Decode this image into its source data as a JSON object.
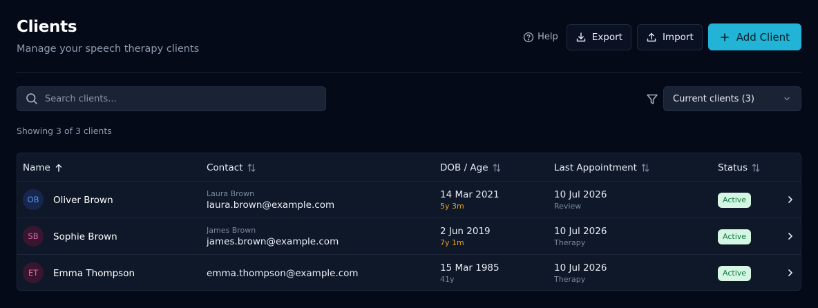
{
  "header": {
    "title": "Clients",
    "subtitle": "Manage your speech therapy clients"
  },
  "toolbar": {
    "help_label": "Help",
    "export_label": "Export",
    "import_label": "Import",
    "add_label": "Add Client"
  },
  "search": {
    "placeholder": "Search clients...",
    "value": ""
  },
  "filter": {
    "selected": "Current clients (3)"
  },
  "summary": "Showing 3 of 3 clients",
  "table": {
    "columns": {
      "name": "Name",
      "contact": "Contact",
      "dob": "DOB / Age",
      "last": "Last Appointment",
      "status": "Status"
    },
    "rows": [
      {
        "initials": "OB",
        "name": "Oliver Brown",
        "contact_name": "Laura Brown",
        "email": "laura.brown@example.com",
        "dob": "14 Mar 2021",
        "age": "5y 3m",
        "last_date": "10 Jul 2026",
        "last_type": "Review",
        "status": "Active",
        "avatar_bg": "#16274d",
        "avatar_fg": "#5f8fe8",
        "age_color": "#e5a11b"
      },
      {
        "initials": "SB",
        "name": "Sophie Brown",
        "contact_name": "James Brown",
        "email": "james.brown@example.com",
        "dob": "2 Jun 2019",
        "age": "7y 1m",
        "last_date": "10 Jul 2026",
        "last_type": "Therapy",
        "status": "Active",
        "avatar_bg": "#3a1530",
        "avatar_fg": "#d06aa8",
        "age_color": "#e5a11b"
      },
      {
        "initials": "ET",
        "name": "Emma Thompson",
        "contact_name": "",
        "email": "emma.thompson@example.com",
        "dob": "15 Mar 1985",
        "age": "41y",
        "last_date": "10 Jul 2026",
        "last_type": "Therapy",
        "status": "Active",
        "avatar_bg": "#3a1530",
        "avatar_fg": "#d06aa8",
        "age_color": "#7c889c"
      }
    ]
  }
}
